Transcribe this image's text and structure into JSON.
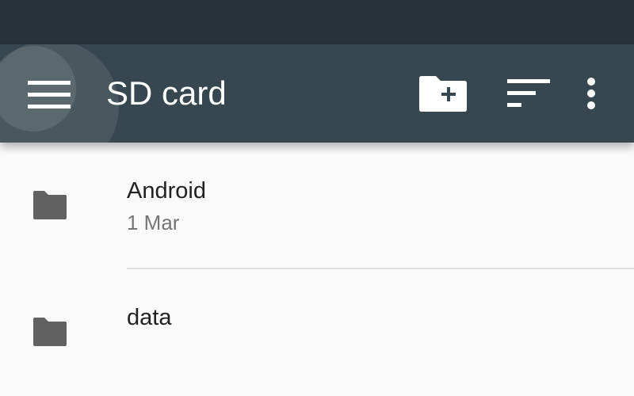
{
  "toolbar": {
    "title": "SD card",
    "icons": {
      "menu": "hamburger-menu-icon",
      "new_folder": "create-new-folder-icon",
      "sort": "sort-icon",
      "overflow": "more-vert-icon"
    }
  },
  "colors": {
    "status_bar": "#263238",
    "toolbar": "#37474f",
    "background": "#fafafa",
    "folder_icon": "#616161",
    "primary_text": "#212121",
    "secondary_text": "#757575"
  },
  "files": [
    {
      "name": "Android",
      "date": "1 Mar",
      "icon": "folder-icon"
    },
    {
      "name": "data",
      "date": "",
      "icon": "folder-icon"
    }
  ]
}
